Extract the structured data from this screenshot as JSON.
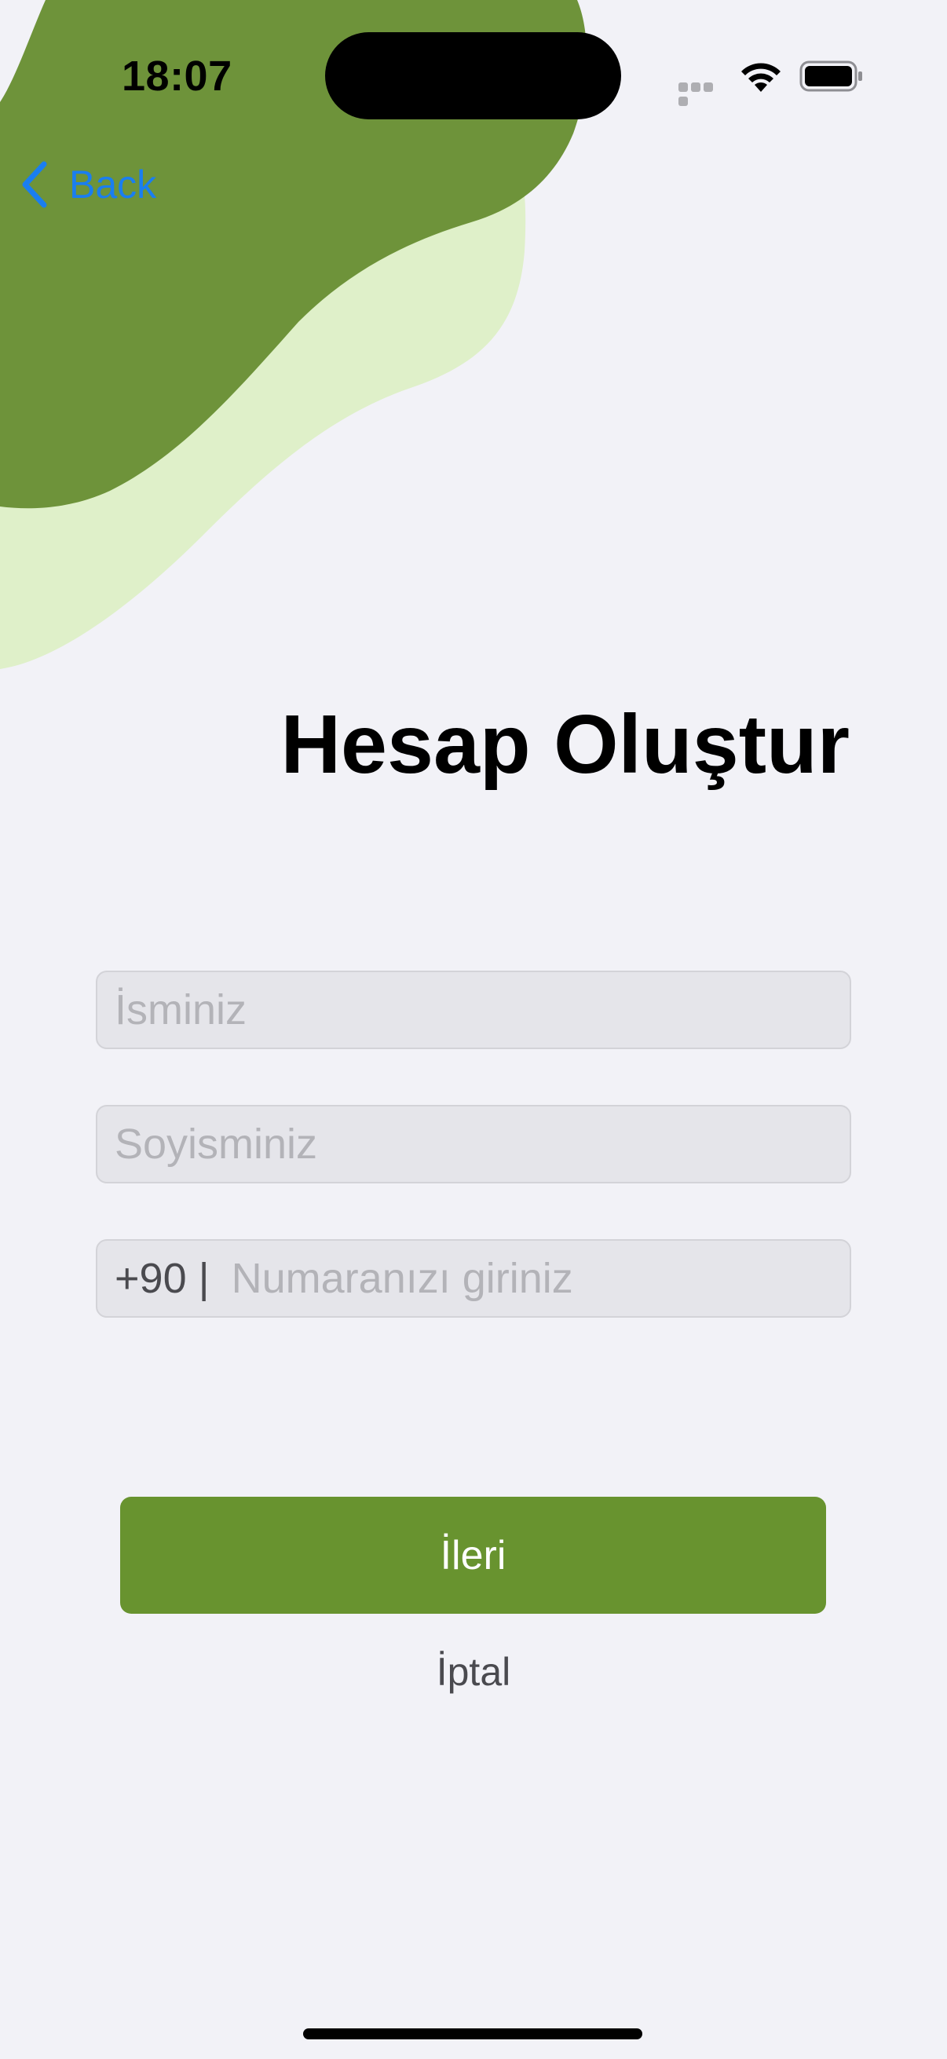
{
  "status_bar": {
    "time": "18:07"
  },
  "nav": {
    "back_label": "Back"
  },
  "page": {
    "title": "Hesap Oluştur"
  },
  "form": {
    "name_placeholder": "İsminiz",
    "surname_placeholder": "Soyisminiz",
    "phone_prefix": "+90 |",
    "phone_placeholder": "Numaranızı giriniz"
  },
  "actions": {
    "next_label": "İleri",
    "cancel_label": "İptal"
  },
  "colors": {
    "background": "#f2f2f7",
    "blob_dark_green": "#6e933a",
    "blob_light_green": "#dff0c9",
    "primary_button": "#68932f",
    "link_blue": "#1a7ef0"
  },
  "icons": {
    "back": "chevron-left-icon",
    "wifi": "wifi-icon",
    "battery": "battery-icon",
    "signal": "cellular-signal-icon"
  }
}
